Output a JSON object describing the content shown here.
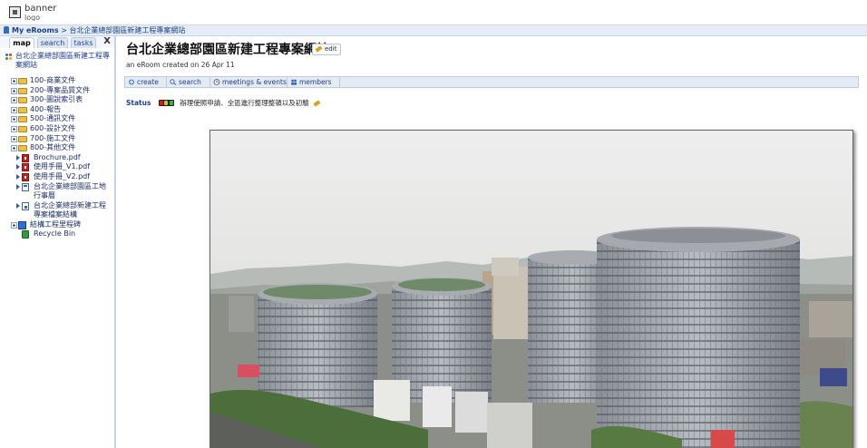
{
  "banner": {
    "text": "banner",
    "text2": "logo"
  },
  "breadcrumb": {
    "home": "My eRooms",
    "separator": ">",
    "current": "台北企業總部園區新建工程專案網站"
  },
  "sidebar": {
    "tabs": [
      {
        "label": "map"
      },
      {
        "label": "search"
      },
      {
        "label": "tasks"
      }
    ],
    "close_label": "X",
    "root_label": "台北企業總部園區新建工程專案網站",
    "items": [
      {
        "label": "100-商業文件"
      },
      {
        "label": "200-專案品質文件"
      },
      {
        "label": "300-圖說索引表"
      },
      {
        "label": "400-報告"
      },
      {
        "label": "500-通訊文件"
      },
      {
        "label": "600-設計文件"
      },
      {
        "label": "700-施工文件"
      },
      {
        "label": "800-其他文件"
      },
      {
        "label": "Brochure.pdf"
      },
      {
        "label": "使用手冊_V1.pdf"
      },
      {
        "label": "使用手冊_V2.pdf"
      },
      {
        "label": "台北企業總部園區工地行事曆"
      },
      {
        "label": "台北企業總部新建工程專案檔案結構"
      },
      {
        "label": "結構工程里程碑"
      },
      {
        "label": "Recycle Bin"
      }
    ]
  },
  "main": {
    "title": "台北企業總部園區新建工程專案網站",
    "edit_label": "edit",
    "subtitle": "an eRoom created on 26 Apr 11",
    "toolbar": {
      "create": "create",
      "search": "search",
      "meetings": "meetings & events",
      "members": "members"
    },
    "status_label": "Status",
    "status_text": "辦理使照申請、全區進行整理整頓以及初驗",
    "colors": {
      "light_red": "#e01818",
      "light_yellow": "#d8c020",
      "light_green": "#20c040"
    }
  }
}
